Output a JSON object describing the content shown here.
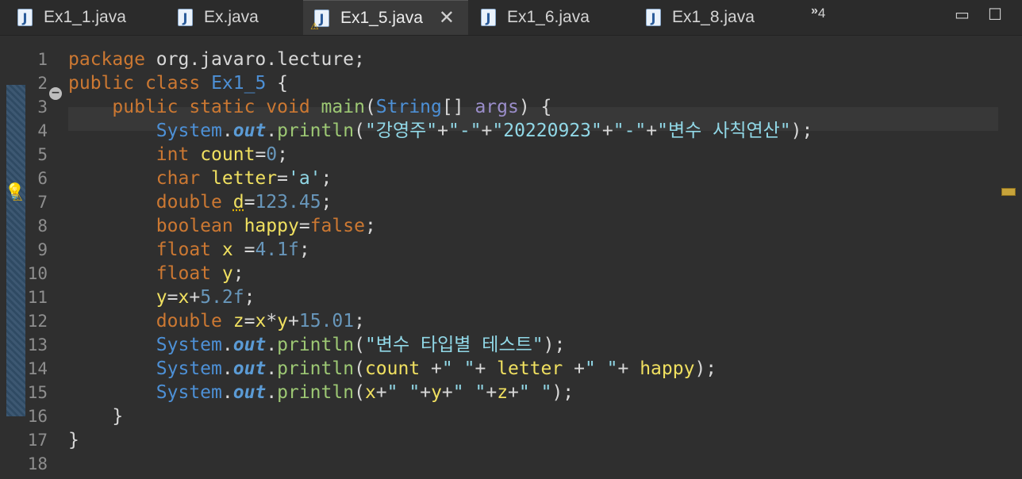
{
  "tabs": [
    {
      "label": "Ex1_1.java",
      "icon": "java-file-icon"
    },
    {
      "label": "Ex.java",
      "icon": "java-file-icon"
    },
    {
      "label": "Ex1_5.java",
      "icon": "java-file-warning-icon",
      "active": true
    },
    {
      "label": "Ex1_6.java",
      "icon": "java-file-icon"
    },
    {
      "label": "Ex1_8.java",
      "icon": "java-file-icon"
    }
  ],
  "overflow": {
    "glyph": "»",
    "count": "4"
  },
  "line_numbers": [
    "1",
    "2",
    "3",
    "4",
    "5",
    "6",
    "7",
    "8",
    "9",
    "10",
    "11",
    "12",
    "13",
    "14",
    "15",
    "16",
    "17",
    "18"
  ],
  "tokens": {
    "l1": [
      "package",
      " org.javaro.lecture;"
    ],
    "l2": [
      "public",
      " ",
      "class",
      " ",
      "Ex1_5",
      " {"
    ],
    "l3": [
      "    ",
      "public",
      " ",
      "static",
      " ",
      "void",
      " ",
      "main",
      "(",
      "String",
      "[] ",
      "args",
      ") {"
    ],
    "l4": [
      "        ",
      "System",
      ".",
      "out",
      ".",
      "println",
      "(",
      "\"강영주\"",
      "+",
      "\"-\"",
      "+",
      "\"20220923\"",
      "+",
      "\"-\"",
      "+",
      "\"변수 사칙연산\"",
      ");"
    ],
    "l5": [
      "        ",
      "int",
      " ",
      "count",
      "=",
      "0",
      ";"
    ],
    "l6": [
      "        ",
      "char",
      " ",
      "letter",
      "=",
      "'a'",
      ";"
    ],
    "l7": [
      "        ",
      "double",
      " ",
      "d",
      "=",
      "123.45",
      ";"
    ],
    "l8": [
      "        ",
      "boolean",
      " ",
      "happy",
      "=",
      "false",
      ";"
    ],
    "l9": [
      "        ",
      "float",
      " ",
      "x",
      " =",
      "4.1f",
      ";"
    ],
    "l10": [
      "        ",
      "float",
      " ",
      "y",
      ";"
    ],
    "l11": [
      "        ",
      "y",
      "=",
      "x",
      "+",
      "5.2f",
      ";"
    ],
    "l12": [
      "        ",
      "double",
      " ",
      "z",
      "=",
      "x",
      "*",
      "y",
      "+",
      "15.01",
      ";"
    ],
    "l13": [
      "        ",
      "System",
      ".",
      "out",
      ".",
      "println",
      "(",
      "\"변수 타입별 테스트\"",
      ");"
    ],
    "l14": [
      "        ",
      "System",
      ".",
      "out",
      ".",
      "println",
      "(",
      "count",
      " +",
      "\" \"",
      "+ ",
      "letter",
      " +",
      "\" \"",
      "+ ",
      "happy",
      ");"
    ],
    "l15": [
      "        ",
      "System",
      ".",
      "out",
      ".",
      "println",
      "(",
      "x",
      "+",
      "\" \"",
      "+",
      "y",
      "+",
      "\" \"",
      "+",
      "z",
      "+",
      "\" \"",
      ");"
    ],
    "l16": [
      "    ",
      "}"
    ],
    "l17": [
      "}"
    ],
    "l18": [
      ""
    ]
  },
  "colors": {
    "keyword": "#cc7832",
    "class": "#4d90d6",
    "variable": "#f0e060",
    "number": "#6897bb",
    "string": "#91d8e7",
    "method": "#9dc874"
  }
}
